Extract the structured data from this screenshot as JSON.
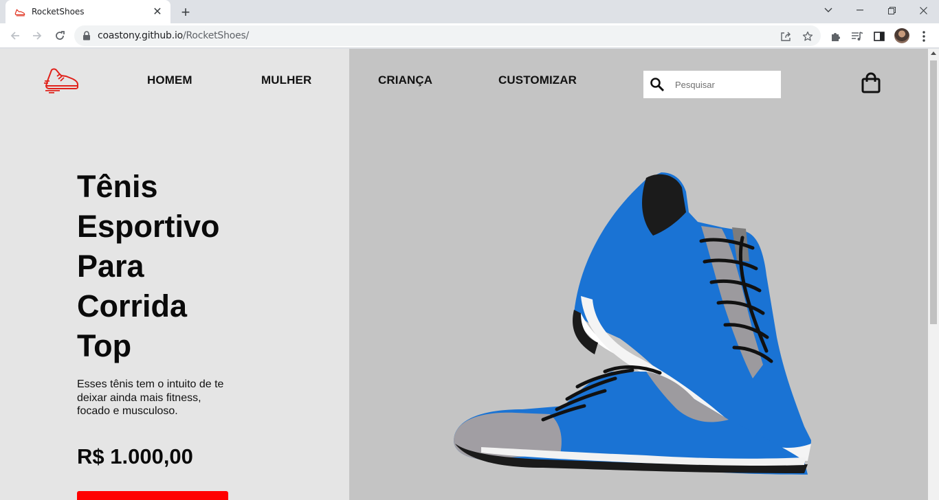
{
  "browser": {
    "tab": {
      "title": "RocketShoes",
      "favicon": "rocketshoes-favicon"
    },
    "address": {
      "host": "coastony.github.io",
      "path": "/RocketShoes/"
    }
  },
  "page": {
    "nav": {
      "logo": "sneaker-logo",
      "links": [
        "HOMEM",
        "MULHER",
        "CRIANÇA",
        "CUSTOMIZAR"
      ]
    },
    "search": {
      "placeholder": "Pesquisar",
      "value": ""
    },
    "cart_icon": "shopping-bag-icon",
    "hero": {
      "title_lines": [
        "Tênis",
        "Esportivo",
        "Para",
        "Corrida",
        "Top"
      ],
      "description_lines": [
        "Esses tênis tem o intuito de te",
        "deixar ainda mais fitness,",
        "focado e musculoso."
      ],
      "price": "R$ 1.000,00",
      "image": "blue-running-sneakers"
    },
    "colors": {
      "accent": "#ff0000",
      "left_bg": "#e5e5e5",
      "right_bg": "#c4c4c4",
      "shoe_blue": "#1a73d4"
    }
  }
}
